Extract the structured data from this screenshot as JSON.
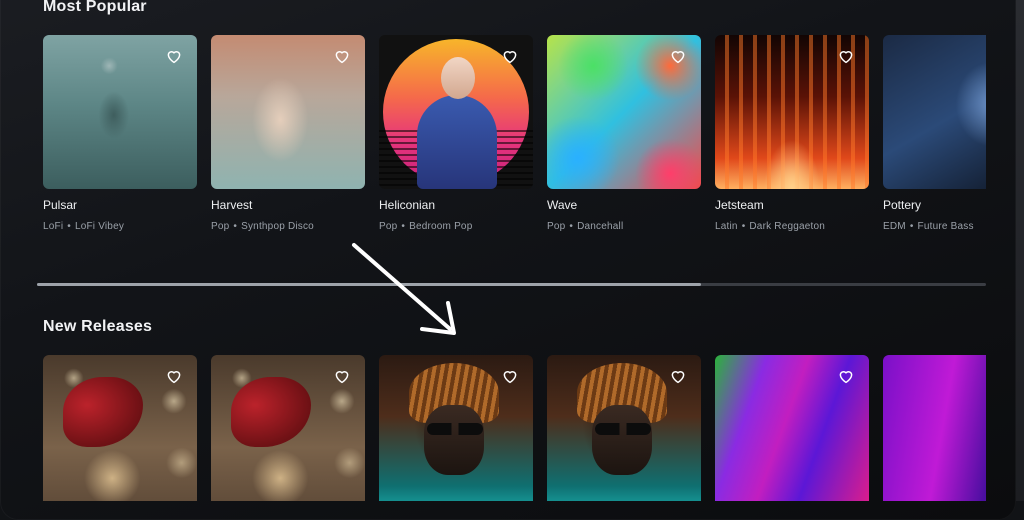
{
  "sections": {
    "most_popular": {
      "title": "Most Popular",
      "items": [
        {
          "title": "Pulsar",
          "genre": "LoFi",
          "subgenre": "LoFi Vibey",
          "art": "muted-teal-portrait"
        },
        {
          "title": "Harvest",
          "genre": "Pop",
          "subgenre": "Synthpop Disco",
          "art": "pastel-glitch-portrait"
        },
        {
          "title": "Heliconian",
          "genre": "Pop",
          "subgenre": "Bedroom Pop",
          "art": "synthwave-sun-portrait"
        },
        {
          "title": "Wave",
          "genre": "Pop",
          "subgenre": "Dancehall",
          "art": "rainbow-swirl"
        },
        {
          "title": "Jetsteam",
          "genre": "Latin",
          "subgenre": "Dark Reggaeton",
          "art": "fire-flames"
        },
        {
          "title": "Pottery",
          "genre": "EDM",
          "subgenre": "Future Bass",
          "art": "blue-hands"
        }
      ]
    },
    "new_releases": {
      "title": "New Releases",
      "items": [
        {
          "art": "red-bow-gift"
        },
        {
          "art": "red-bow-gift"
        },
        {
          "art": "dreadlocks-portrait"
        },
        {
          "art": "dreadlocks-portrait"
        },
        {
          "art": "purple-green-streaks"
        },
        {
          "art": "purple-streaks"
        }
      ]
    }
  },
  "scroll": {
    "position_fraction": 0.0,
    "visible_fraction": 0.7
  },
  "icons": {
    "favorite": "heart-outline-icon",
    "annotation": "arrow-pointer"
  },
  "colors": {
    "background": "#111316",
    "text": "#eef0f2",
    "meta": "#9aa0a8",
    "scroll_thumb": "#9ea3aa"
  }
}
